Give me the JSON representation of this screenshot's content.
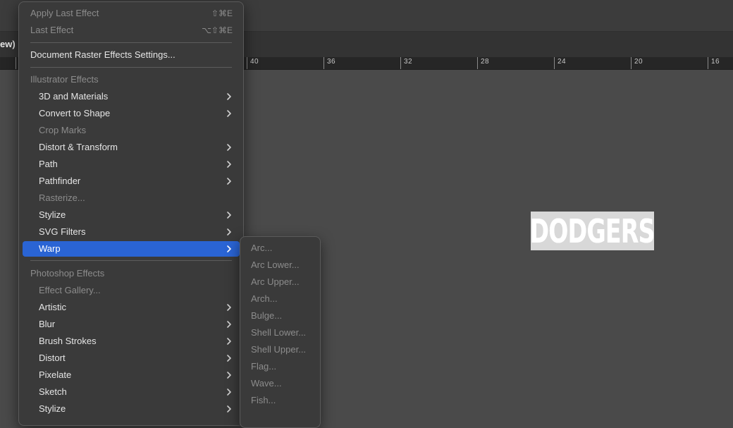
{
  "control_bar": {
    "partial_label": "ew)"
  },
  "ruler": {
    "labels": [
      "40",
      "36",
      "32",
      "28",
      "24",
      "20",
      "16"
    ]
  },
  "artwork": {
    "text": "DODGERS"
  },
  "menu": {
    "top_items": [
      {
        "label": "Apply Last Effect",
        "shortcut": "⇧⌘E",
        "disabled": true
      },
      {
        "label": "Last Effect",
        "shortcut": "⌥⇧⌘E",
        "disabled": true
      }
    ],
    "settings_item": "Document Raster Effects Settings...",
    "illustrator_header": "Illustrator Effects",
    "illustrator_items": [
      {
        "label": "3D and Materials",
        "submenu": true
      },
      {
        "label": "Convert to Shape",
        "submenu": true
      },
      {
        "label": "Crop Marks",
        "disabled": true
      },
      {
        "label": "Distort & Transform",
        "submenu": true
      },
      {
        "label": "Path",
        "submenu": true
      },
      {
        "label": "Pathfinder",
        "submenu": true
      },
      {
        "label": "Rasterize...",
        "disabled": true
      },
      {
        "label": "Stylize",
        "submenu": true
      },
      {
        "label": "SVG Filters",
        "submenu": true
      },
      {
        "label": "Warp",
        "submenu": true,
        "highlighted": true
      }
    ],
    "photoshop_header": "Photoshop Effects",
    "photoshop_items": [
      {
        "label": "Effect Gallery...",
        "disabled": true
      },
      {
        "label": "Artistic",
        "submenu": true
      },
      {
        "label": "Blur",
        "submenu": true
      },
      {
        "label": "Brush Strokes",
        "submenu": true
      },
      {
        "label": "Distort",
        "submenu": true
      },
      {
        "label": "Pixelate",
        "submenu": true
      },
      {
        "label": "Sketch",
        "submenu": true
      },
      {
        "label": "Stylize",
        "submenu": true
      }
    ]
  },
  "warp_submenu": {
    "items": [
      "Arc...",
      "Arc Lower...",
      "Arc Upper...",
      "Arch...",
      "Bulge...",
      "Shell Lower...",
      "Shell Upper...",
      "Flag...",
      "Wave...",
      "Fish..."
    ]
  },
  "colors": {
    "highlight": "#2a64d4",
    "menu_bg": "#3a3a3a",
    "canvas": "#4a4a4a"
  },
  "icons": {
    "submenu_arrow": "chevron-right-icon"
  }
}
